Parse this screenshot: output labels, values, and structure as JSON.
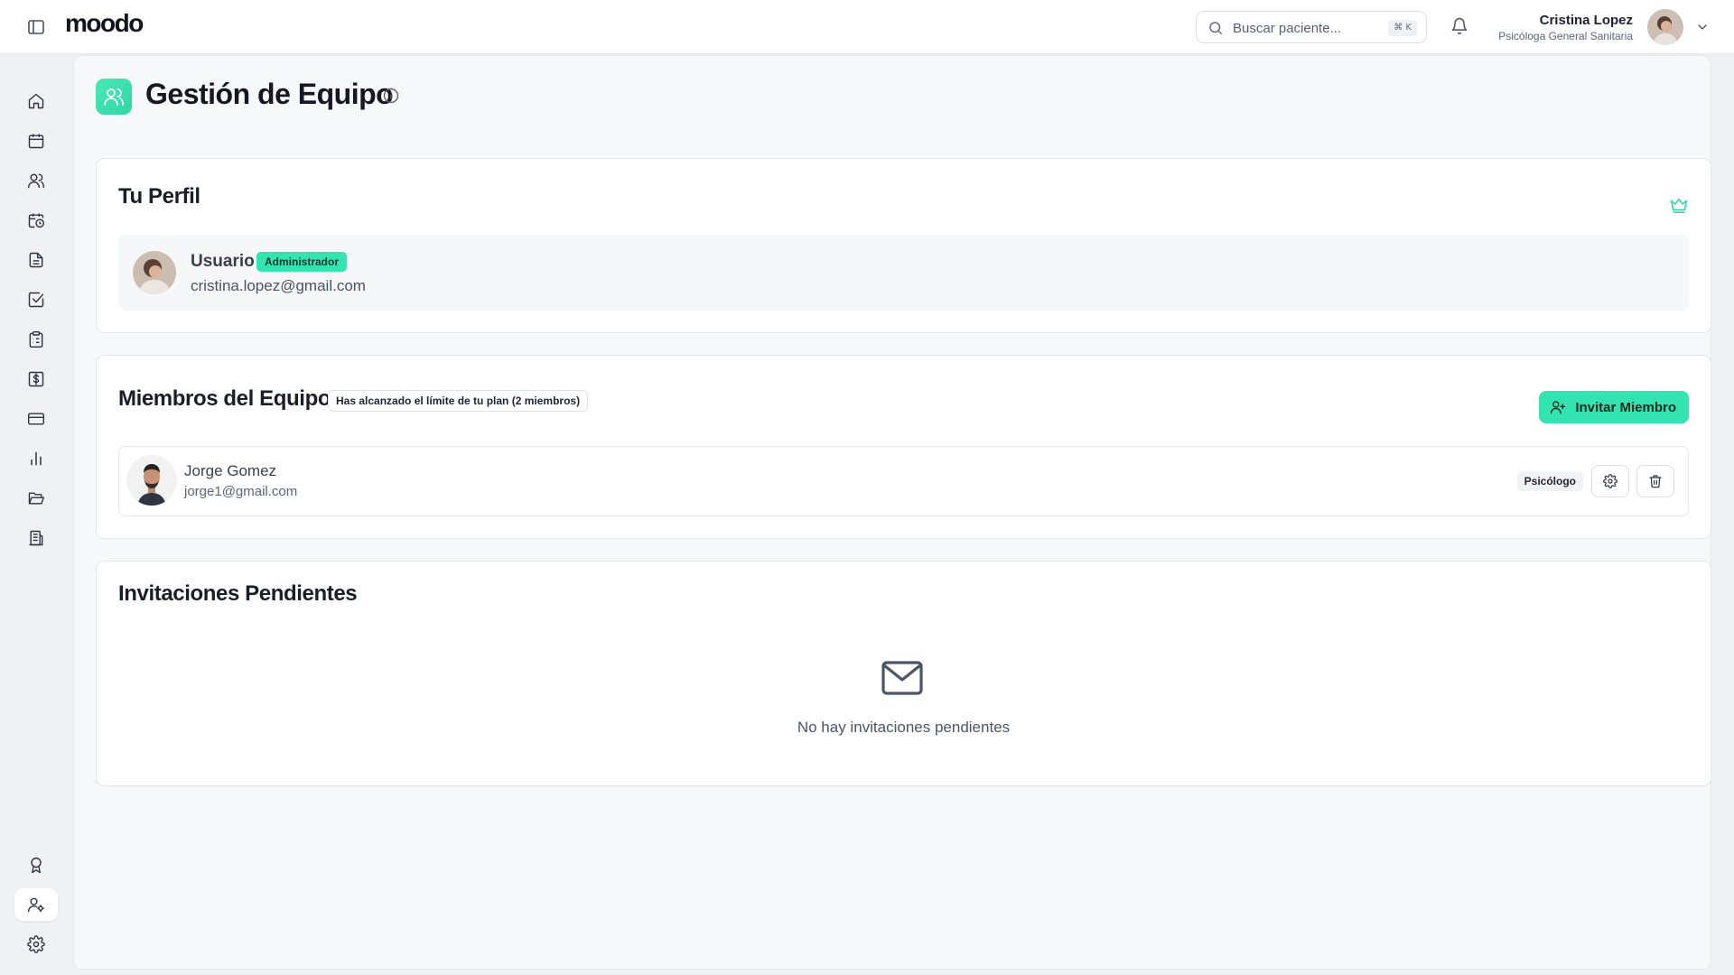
{
  "app": {
    "logo": "moodo"
  },
  "header": {
    "search": {
      "placeholder": "Buscar paciente...",
      "shortcut": "⌘ K"
    },
    "user": {
      "name": "Cristina Lopez",
      "role": "Psicóloga General Sanitaria"
    }
  },
  "sidebar": {
    "items": [
      {
        "name": "home",
        "icon": "home-icon"
      },
      {
        "name": "calendar",
        "icon": "calendar-icon"
      },
      {
        "name": "patients",
        "icon": "users-icon"
      },
      {
        "name": "schedule",
        "icon": "calendar-clock-icon"
      },
      {
        "name": "documents",
        "icon": "file-text-icon"
      },
      {
        "name": "tasks",
        "icon": "check-square-icon"
      },
      {
        "name": "clipboard",
        "icon": "clipboard-list-icon"
      },
      {
        "name": "billing",
        "icon": "dollar-square-icon"
      },
      {
        "name": "payments",
        "icon": "credit-card-icon"
      },
      {
        "name": "statistics",
        "icon": "bar-chart-icon"
      },
      {
        "name": "files",
        "icon": "folder-open-icon"
      },
      {
        "name": "clinic",
        "icon": "building-icon"
      },
      {
        "name": "achievements",
        "icon": "award-icon"
      },
      {
        "name": "team",
        "icon": "user-cog-icon",
        "active": true
      },
      {
        "name": "settings",
        "icon": "gear-icon"
      }
    ]
  },
  "page": {
    "title": "Gestión de Equipo"
  },
  "profile_card": {
    "title": "Tu Perfil",
    "name": "Usuario",
    "badge": "Administrador",
    "email": "cristina.lopez@gmail.com"
  },
  "members_card": {
    "title": "Miembros del Equipo",
    "limit_notice": "Has alcanzado el límite de tu plan (2 miembros)",
    "invite_label": "Invitar Miembro",
    "members": [
      {
        "name": "Jorge Gomez",
        "email": "jorge1@gmail.com",
        "role": "Psicólogo"
      }
    ]
  },
  "invitations_card": {
    "title": "Invitaciones Pendientes",
    "empty_text": "No hay invitaciones pendientes"
  },
  "colors": {
    "accent": "#33e3b0",
    "background": "#eff1f4",
    "text": "#1f2430"
  }
}
